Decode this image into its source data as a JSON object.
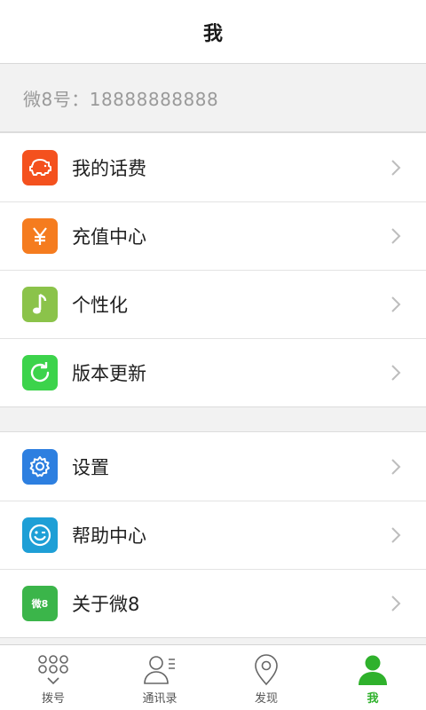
{
  "header": {
    "title": "我"
  },
  "account": {
    "text": "微8号：18888888888"
  },
  "group1": [
    {
      "label": "我的话费",
      "icon": "piggy-bank-icon",
      "color": "#f4511e"
    },
    {
      "label": "充值中心",
      "icon": "yen-icon",
      "color": "#f57c1f"
    },
    {
      "label": "个性化",
      "icon": "music-note-icon",
      "color": "#8bc34a"
    },
    {
      "label": "版本更新",
      "icon": "refresh-icon",
      "color": "#3cd34b"
    }
  ],
  "group2": [
    {
      "label": "设置",
      "icon": "gear-icon",
      "color": "#2d7fe0"
    },
    {
      "label": "帮助中心",
      "icon": "smiley-icon",
      "color": "#1e9fd6"
    },
    {
      "label": "关于微8",
      "icon": "wei8-logo-icon",
      "color": "#3bb54a",
      "badge": "微8"
    }
  ],
  "tabs": [
    {
      "label": "拨号",
      "icon": "dialpad-icon"
    },
    {
      "label": "通讯录",
      "icon": "contacts-icon"
    },
    {
      "label": "发现",
      "icon": "location-pin-icon"
    },
    {
      "label": "我",
      "icon": "person-icon",
      "active": true
    }
  ],
  "colors": {
    "accent": "#2fb12c",
    "chevron": "#bdbdbd"
  }
}
